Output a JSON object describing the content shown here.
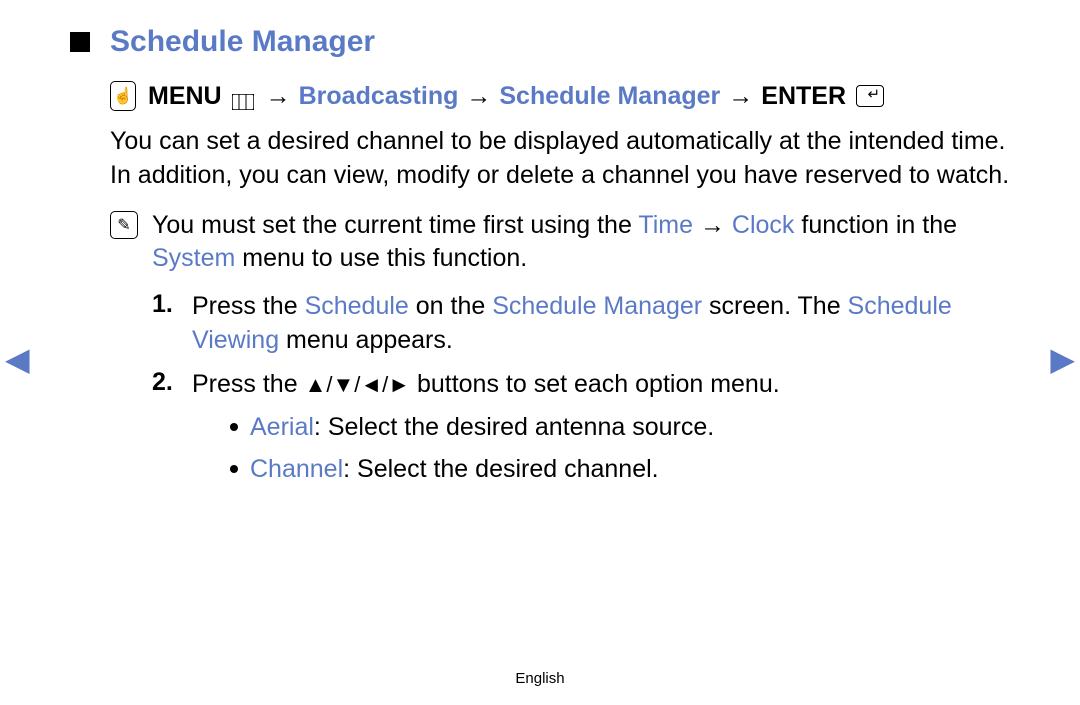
{
  "title": "Schedule Manager",
  "breadcrumb": {
    "menu_label": "MENU",
    "path1": "Broadcasting",
    "path2": "Schedule Manager",
    "enter_label": "ENTER"
  },
  "intro": "You can set a desired channel to be displayed automatically at the intended time. In addition, you can view, modify or delete a channel you have reserved to watch.",
  "note": {
    "prefix": "You must set the current time first using the ",
    "link1": "Time",
    "arrow": " → ",
    "link2": "Clock",
    "mid": " function in the ",
    "link3": "System",
    "suffix": " menu to use this function."
  },
  "steps": [
    {
      "num": "1.",
      "parts": {
        "a": "Press the ",
        "b": "Schedule",
        "c": " on the ",
        "d": "Schedule Manager",
        "e": " screen. The ",
        "f": "Schedule Viewing",
        "g": " menu appears."
      }
    },
    {
      "num": "2.",
      "parts": {
        "a": "Press the ",
        "buttons": "▲/▼/◄/►",
        "b": " buttons to set each option menu."
      }
    }
  ],
  "bullets": [
    {
      "label": "Aerial",
      "text": ": Select the desired antenna source."
    },
    {
      "label": "Channel",
      "text": ": Select the desired channel."
    }
  ],
  "footer": "English",
  "icons": {
    "hand": "☝",
    "note": "✎"
  }
}
